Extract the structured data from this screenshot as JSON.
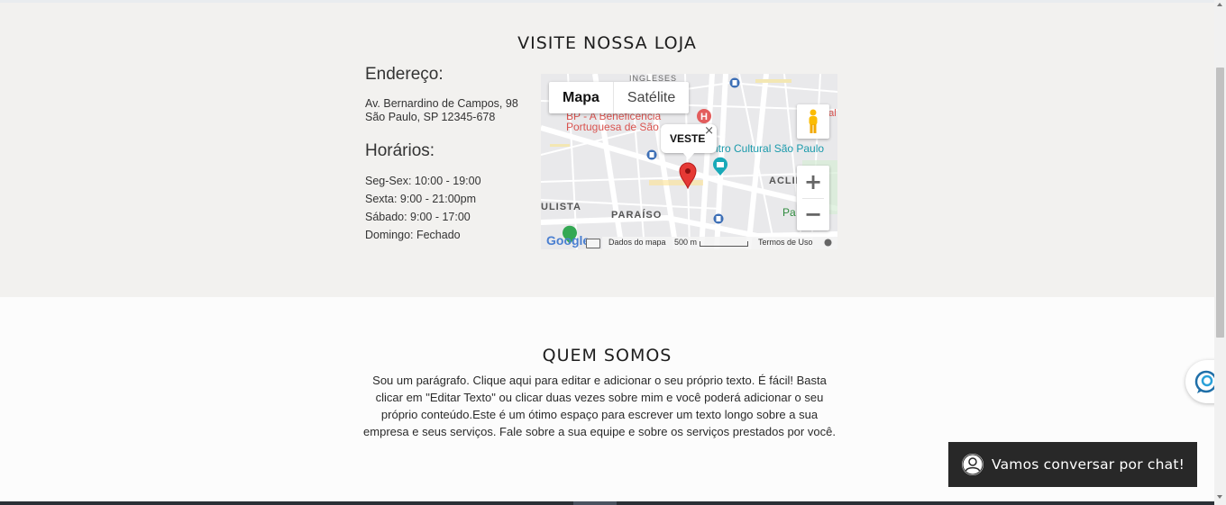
{
  "store": {
    "title": "VISITE NOSSA LOJA",
    "address_heading": "Endereço:",
    "address_line1": "Av. Bernardino de Campos, 98",
    "address_line2": "São Paulo, SP 12345-678",
    "hours_heading": "Horários:",
    "hours": [
      "Seg-Sex: 10:00 - 19:00",
      "Sexta: 9:00 - 21:00pm",
      "Sábado: 9:00 - 17:00",
      "Domingo: Fechado"
    ]
  },
  "map": {
    "type_map": "Mapa",
    "type_satellite": "Satélite",
    "marker_name": "VESTE",
    "close_glyph": "×",
    "zoom_in": "+",
    "zoom_out": "−",
    "labels": {
      "ingleses": "INGLESES",
      "beneficencia": "BP - A Beneficência",
      "portuguesa": "Portuguesa de São",
      "centro_cultural": "ntro Cultural São Paulo",
      "aclimacao": "ACLIMAÇÃ",
      "ulista": "ULISTA",
      "paraiso": "PARAÍSO",
      "hospital": "Hospital C",
      "pa": "Pa"
    },
    "google": "Google",
    "map_data": "Dados do mapa",
    "scale": "500 m",
    "terms": "Termos de Uso"
  },
  "about": {
    "title": "QUEM SOMOS",
    "text": "Sou um parágrafo. Clique aqui para editar e adicionar o seu próprio texto. É fácil! Basta clicar em \"Editar Texto\" ou clicar duas vezes sobre mim e você poderá adicionar o seu próprio conteúdo.Este é um ótimo espaço para escrever um texto longo sobre a sua empresa e seus serviços. Fale sobre a sua equipe e sobre os serviços prestados por você."
  },
  "chat": {
    "label": "Vamos conversar por chat!"
  },
  "icons": {
    "marker": "map-pin-icon",
    "pegman": "street-view-icon",
    "chat_avatar": "user-icon",
    "widget": "chat-bubble-icon"
  },
  "colors": {
    "store_bg": "#f2f1ef",
    "chat_bg": "#282828",
    "marker": "#e53935",
    "museum": "#19a9b8",
    "park": "#34a853"
  }
}
